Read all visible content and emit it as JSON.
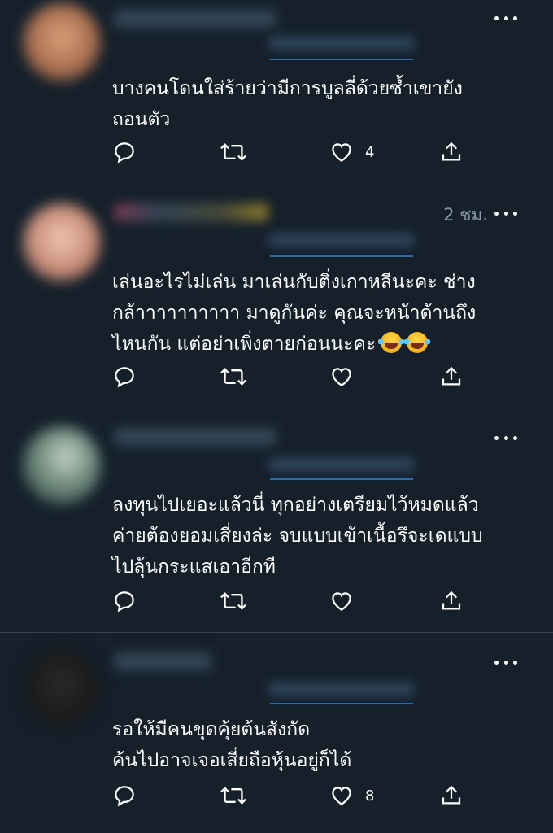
{
  "tweets": [
    {
      "time": "",
      "text": "บางคนโดนใส่ร้ายว่ามีการบูลลี่ด้วยซ้ำเขายัง\nถอนตัว",
      "reply_count": "",
      "retweet_count": "",
      "like_count": "4"
    },
    {
      "time": "2 ชม.",
      "text": "เล่นอะไรไม่เล่น มาเล่นกับติ่งเกาหลีนะคะ ช่าง\nกล้าาาาาาาาาา มาดูกันค่ะ คุณจะหน้าด้านถึง\nไหนกัน แต่อย่าเพิ่งตายก่อนนะคะ",
      "emoji": [
        "face-with-tears-of-joy",
        "face-with-tears-of-joy"
      ],
      "reply_count": "",
      "retweet_count": "",
      "like_count": ""
    },
    {
      "time": "",
      "text": "ลงทุนไปเยอะแล้วนี่ ทุกอย่างเตรียมไว้หมดแล้ว\nค่ายต้องยอมเสี่ยงล่ะ จบแบบเข้าเนื้อรึจะเดแบบ\nไปลุ้นกระแสเอาอีกที",
      "reply_count": "",
      "retweet_count": "",
      "like_count": ""
    },
    {
      "time": "",
      "text": "รอให้มีคนขุดคุ้ยต้นสังกัด\nค้นไปอาจเจอเสี่ยถือหุ้นอยู่ก็ได้",
      "reply_count": "",
      "retweet_count": "",
      "like_count": "8"
    }
  ],
  "icons": {
    "reply": "reply-icon",
    "retweet": "retweet-icon",
    "like": "heart-icon",
    "share": "share-icon",
    "more": "more-icon"
  },
  "colors": {
    "background": "#15202b",
    "divider": "#38444d",
    "text": "#ffffff",
    "secondary": "#8899a6"
  }
}
